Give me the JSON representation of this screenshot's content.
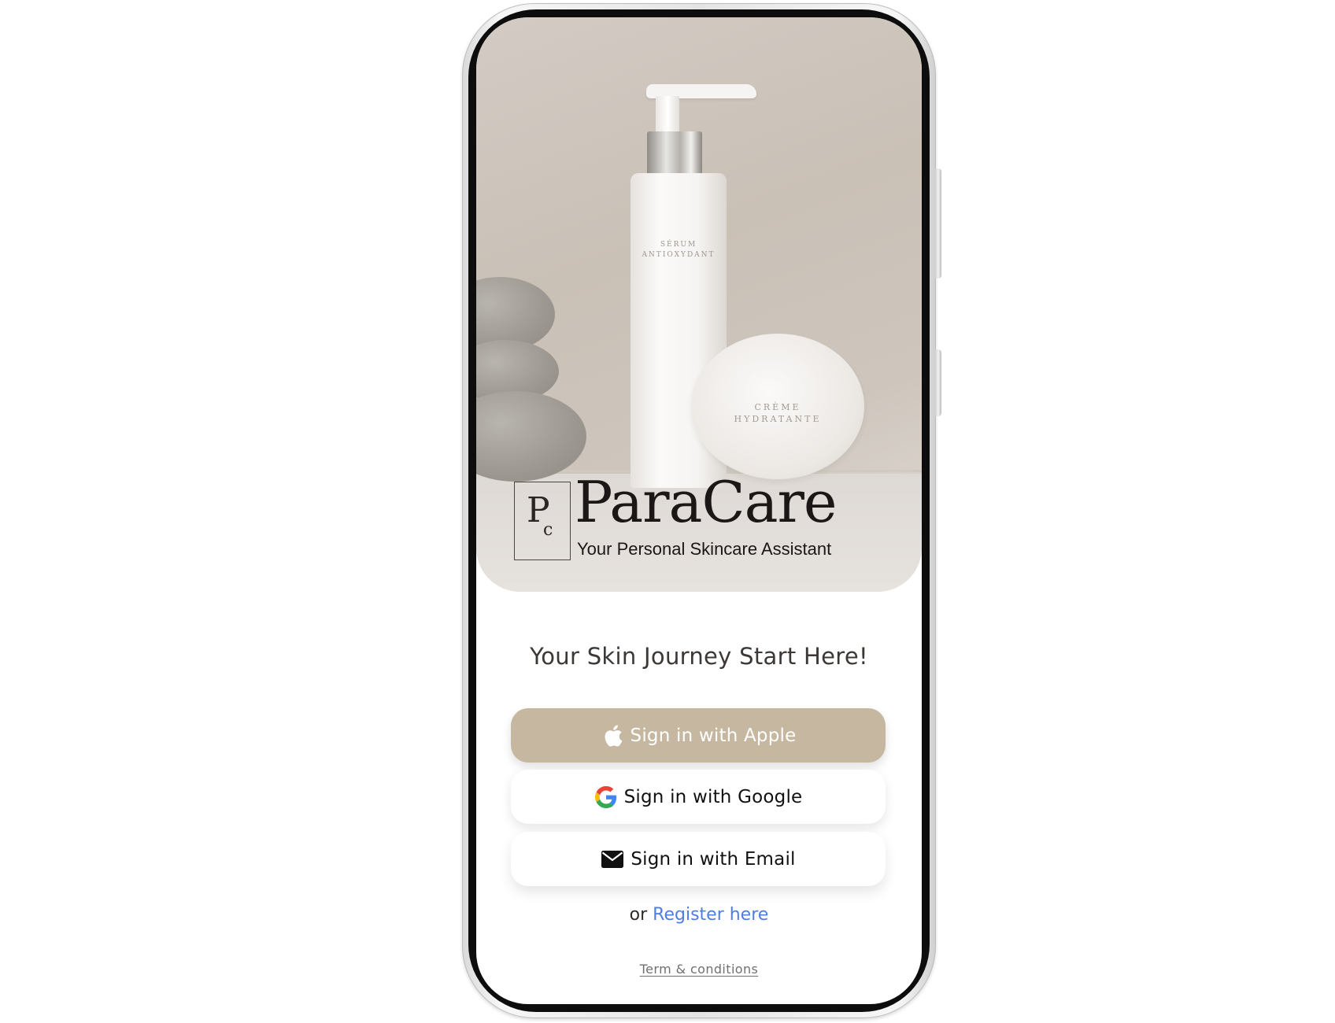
{
  "hero": {
    "bottle_label": "SÉRUM\nANTIOXYDANT",
    "jar_label": "CRÈME\nHYDRATANTE"
  },
  "brand": {
    "logo_letters": "P",
    "logo_letters_small": "c",
    "name": "ParaCare",
    "tagline": "Your Personal Skincare Assistant"
  },
  "headline": "Your Skin Journey Start Here!",
  "buttons": {
    "apple": {
      "label": "Sign in with Apple",
      "icon": "apple-icon"
    },
    "google": {
      "label": "Sign in with Google",
      "icon": "google-icon"
    },
    "email": {
      "label": "Sign in with Email",
      "icon": "envelope-icon"
    }
  },
  "register": {
    "prefix": "or",
    "link": "Register here"
  },
  "terms": "Term & conditions",
  "colors": {
    "accent": "#c6b7a0",
    "link": "#4d7ee6",
    "text": "#3c3836"
  }
}
